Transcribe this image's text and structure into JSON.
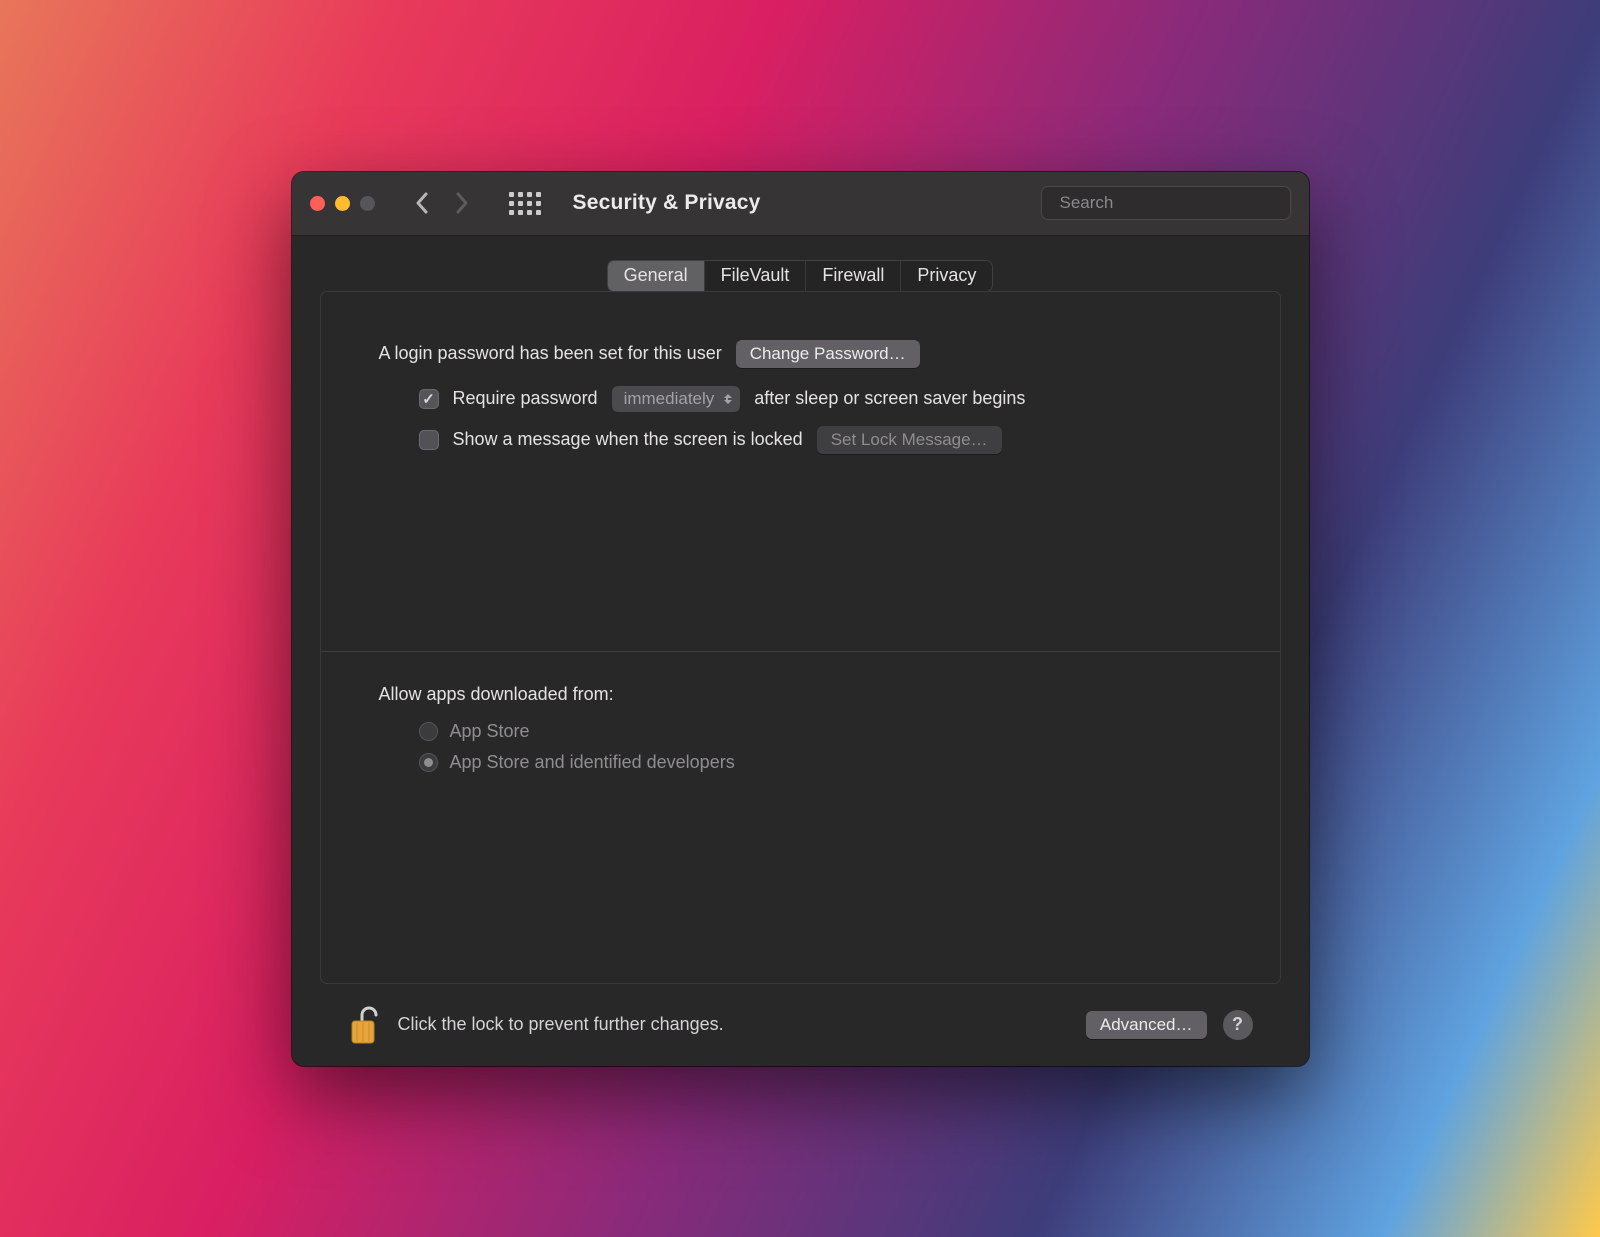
{
  "header": {
    "title": "Security & Privacy",
    "search_placeholder": "Search"
  },
  "tabs": [
    {
      "label": "General",
      "active": true
    },
    {
      "label": "FileVault",
      "active": false
    },
    {
      "label": "Firewall",
      "active": false
    },
    {
      "label": "Privacy",
      "active": false
    }
  ],
  "general": {
    "password_set_text": "A login password has been set for this user",
    "change_password_label": "Change Password…",
    "require_password_prefix": "Require password",
    "require_password_delay": "immediately",
    "require_password_suffix": "after sleep or screen saver begins",
    "require_password_checked": true,
    "show_message_label": "Show a message when the screen is locked",
    "show_message_checked": false,
    "set_lock_message_label": "Set Lock Message…",
    "allow_apps_label": "Allow apps downloaded from:",
    "radio_options": [
      {
        "label": "App Store",
        "selected": false
      },
      {
        "label": "App Store and identified developers",
        "selected": true
      }
    ]
  },
  "footer": {
    "lock_text": "Click the lock to prevent further changes.",
    "advanced_label": "Advanced…",
    "help_label": "?"
  }
}
